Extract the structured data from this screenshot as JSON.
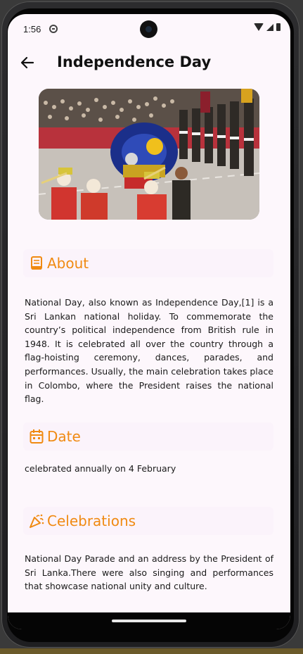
{
  "status_bar": {
    "time": "1:56"
  },
  "app_bar": {
    "title": "Independence Day"
  },
  "sections": {
    "about": {
      "title": "About",
      "text": "National Day, also known as Independence Day,[1] is a Sri Lankan national holiday. To commemorate the country’s political independence from British rule in 1948. It is celebrated all over the country through a flag-hoisting ceremony, dances, parades, and performances. Usually, the main celebration takes place in Colombo, where the President raises the national flag."
    },
    "date": {
      "title": "Date",
      "text": "celebrated annually on 4 February"
    },
    "celebrations": {
      "title": "Celebrations",
      "text": "National Day Parade and an address by the President of Sri Lanka.There were also singing and performances that showcase national unity and culture."
    }
  },
  "colors": {
    "accent": "#f08a12",
    "background": "#fdf7fc"
  },
  "icons": [
    "back-arrow-icon",
    "book-icon",
    "calendar-icon",
    "party-popper-icon",
    "wifi-icon",
    "signal-icon",
    "battery-icon"
  ]
}
